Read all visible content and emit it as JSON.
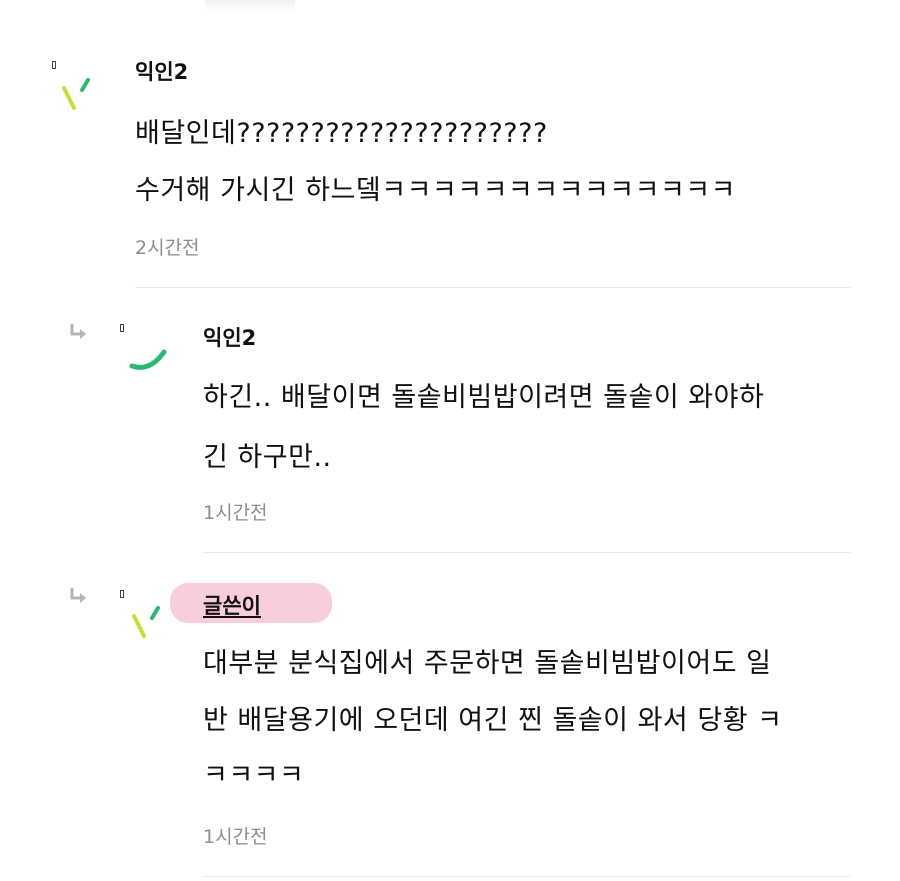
{
  "comments": [
    {
      "author": "익인2",
      "lines": [
        "배달인데?????????????????????",
        "수거해 가시긴 하느뎈ㅋㅋㅋㅋㅋㅋㅋㅋㅋㅋㅋㅋㅋㅋ"
      ],
      "time": "2시간전",
      "is_reply": false
    },
    {
      "author": "익인2",
      "lines": [
        "하긴.. 배달이면 돌솥비빔밥이려면 돌솥이 와야하",
        "긴 하구만.."
      ],
      "time": "1시간전",
      "is_reply": true
    },
    {
      "author": "글쓴이",
      "lines": [
        "대부분 분식집에서 주문하면 돌솥비빔밥이어도 일",
        "반 배달용기에 오던데 여긴 찐 돌솥이 와서 당황 ㅋ",
        "ㅋㅋㅋㅋ"
      ],
      "time": "1시간전",
      "is_reply": true
    }
  ],
  "icons": {
    "reply": "reply-arrow-icon",
    "avatar": "avatar-icon",
    "marker": "square-marker-icon"
  },
  "colors": {
    "avatar_lime": "#c8dd3a",
    "avatar_green": "#2bb873",
    "highlight": "#f7c6d8",
    "reply_arrow": "#b5b5b5"
  }
}
